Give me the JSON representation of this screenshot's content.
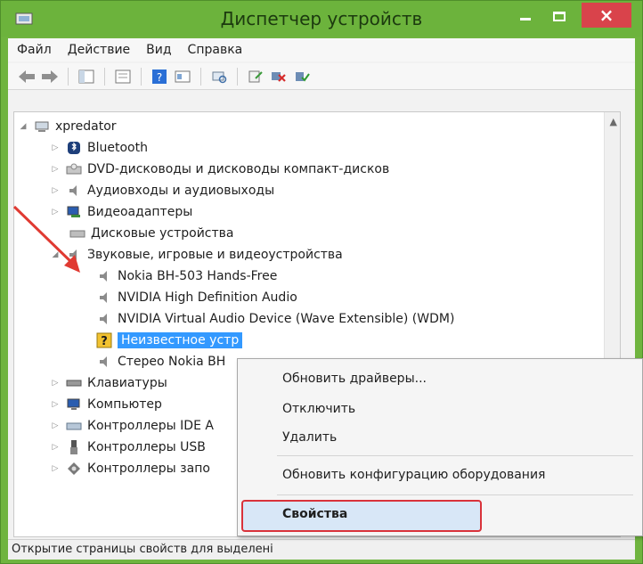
{
  "window": {
    "title": "Диспетчер устройств",
    "close_glyph": "×"
  },
  "menu": [
    "Файл",
    "Действие",
    "Вид",
    "Справка"
  ],
  "tree": {
    "root": "xpredator",
    "items": [
      "Bluetooth",
      "DVD-дисководы и дисководы компакт-дисков",
      "Аудиовходы и аудиовыходы",
      "Видеоадаптеры",
      "Дисковые устройства",
      "Звуковые, игровые и видеоустройства",
      "Nokia BH-503 Hands-Free",
      "NVIDIA High Definition Audio",
      "NVIDIA Virtual Audio Device (Wave Extensible) (WDM)",
      "Неизвестное устр",
      "Стерео Nokia BH",
      "Клавиатуры",
      "Компьютер",
      "Контроллеры IDE A",
      "Контроллеры USB",
      "Контроллеры запо"
    ]
  },
  "context_menu": {
    "items": [
      "Обновить драйверы...",
      "Отключить",
      "Удалить",
      "Обновить конфигурацию оборудования",
      "Свойства"
    ]
  },
  "status": "Открытие страницы свойств для выделені",
  "colors": {
    "titlebar": "#6cb33c",
    "close": "#d9434b",
    "selection": "#3399ff",
    "highlight_border": "#d9323a"
  }
}
